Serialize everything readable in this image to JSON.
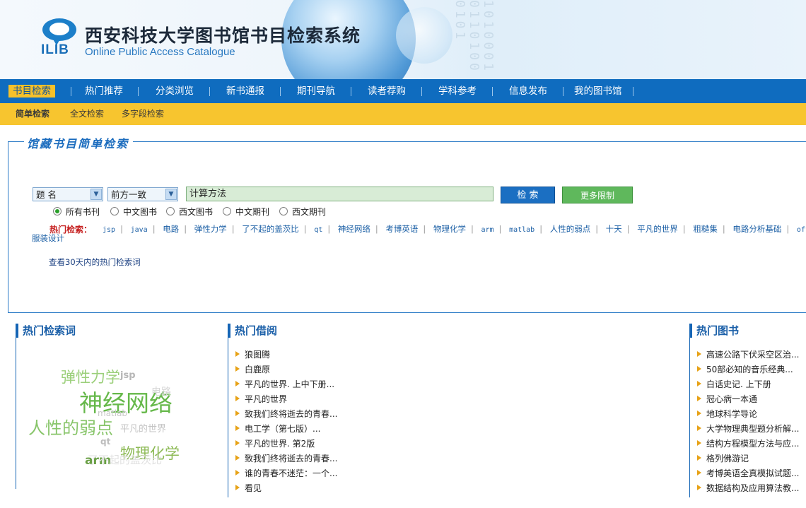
{
  "header": {
    "logo_text": "ILIB",
    "title": "西安科技大学图书馆书目检索系统",
    "subtitle": "Online Public Access Catalogue",
    "binary_text": "1010001 0110100 0101"
  },
  "nav": {
    "items": [
      "书目检索",
      "热门推荐",
      "分类浏览",
      "新书通报",
      "期刊导航",
      "读者荐购",
      "学科参考",
      "信息发布",
      "我的图书馆"
    ]
  },
  "subnav": {
    "items": [
      "简单检索",
      "全文检索",
      "多字段检索"
    ]
  },
  "search": {
    "legend": "馆藏书目简单检索",
    "field_select": "题 名",
    "match_select": "前方一致",
    "query_value": "计算方法",
    "search_button": "检 索",
    "more_button": "更多限制",
    "radio_options": [
      "所有书刊",
      "中文图书",
      "西文图书",
      "中文期刊",
      "西文期刊"
    ],
    "radio_selected": "所有书刊",
    "hot_label": "热门检索：",
    "hot_keywords": [
      "jsp",
      "java",
      "电路",
      "弹性力学",
      "了不起的盖茨比",
      "qt",
      "神经网络",
      "考博英语",
      "物理化学",
      "arm",
      "matlab",
      "人性的弱点",
      "十天",
      "平凡的世界",
      "粗糙集",
      "电路分析基础",
      "office"
    ],
    "hot_keywords_line2": "服装设计",
    "link_30days": "查看30天内的热门检索词"
  },
  "sections": {
    "hot_search": {
      "title": "热门检索词",
      "cloud": [
        "弹性力学",
        "jsp",
        "神经网络",
        "电路",
        "matlab",
        "人性的弱点",
        "平凡的世界",
        "qt",
        "物理化学",
        "arm",
        "了不起的盖茨比"
      ]
    },
    "hot_borrow": {
      "title": "热门借阅",
      "items": [
        "狼图腾",
        "白鹿原",
        "平凡的世界. 上中下册...",
        "平凡的世界",
        "致我们终将逝去的青春...",
        "电工学（第七版）...",
        "平凡的世界. 第2版",
        "致我们终将逝去的青春...",
        "谁的青春不迷茫：一个...",
        "看见"
      ]
    },
    "hot_books": {
      "title": "热门图书",
      "items": [
        "高速公路下伏采空区治...",
        "50部必知的音乐经典...",
        "白话史记. 上下册",
        "冠心病一本通",
        "地球科学导论",
        "大学物理典型题分析解...",
        "结构方程模型方法与应...",
        "格列佛游记",
        "考博英语全真模拟试题...",
        "数据结构及应用算法教..."
      ]
    }
  },
  "colors": {
    "nav_blue": "#0f6cbf",
    "subnav_yellow": "#f7c52f",
    "accent_blue": "#1b6cbe",
    "hot_red": "#c51f1f",
    "cloud_green": "#66b84a"
  }
}
